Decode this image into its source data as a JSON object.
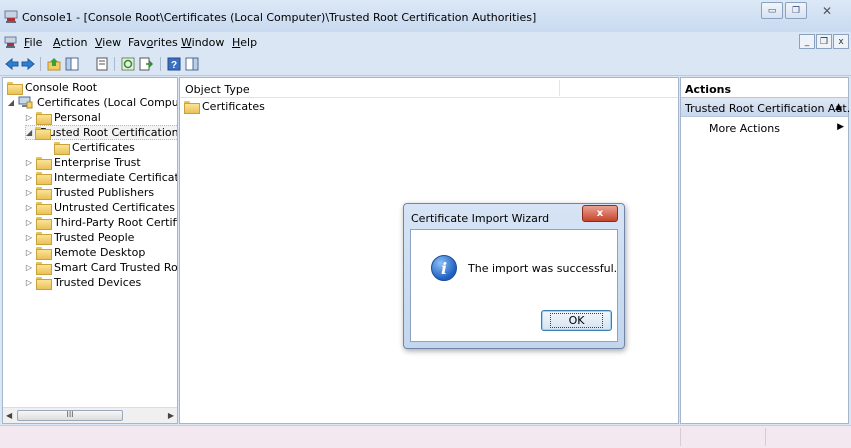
{
  "window": {
    "title": "Console1 - [Console Root\\Certificates (Local Computer)\\Trusted Root Certification Authorities]",
    "minimize_glyph": "▭",
    "restore_glyph": "❐",
    "close_glyph": "✕"
  },
  "menu": {
    "items": [
      {
        "pre": "",
        "ul": "F",
        "post": "ile"
      },
      {
        "pre": "",
        "ul": "A",
        "post": "ction"
      },
      {
        "pre": "",
        "ul": "V",
        "post": "iew"
      },
      {
        "pre": "Fav",
        "ul": "o",
        "post": "rites"
      },
      {
        "pre": "",
        "ul": "W",
        "post": "indow"
      },
      {
        "pre": "",
        "ul": "H",
        "post": "elp"
      }
    ],
    "mdi_minimize": "_",
    "mdi_restore": "❐",
    "mdi_close": "x"
  },
  "tree": {
    "items": [
      {
        "label": "Console Root",
        "expander": ""
      },
      {
        "label": "Certificates (Local Computer)",
        "expander": "◢"
      },
      {
        "label": "Personal",
        "expander": "▷"
      },
      {
        "label": "Trusted Root Certification Au",
        "expander": "◢"
      },
      {
        "label": "Certificates",
        "expander": ""
      },
      {
        "label": "Enterprise Trust",
        "expander": "▷"
      },
      {
        "label": "Intermediate Certification Au",
        "expander": "▷"
      },
      {
        "label": "Trusted Publishers",
        "expander": "▷"
      },
      {
        "label": "Untrusted Certificates",
        "expander": "▷"
      },
      {
        "label": "Third-Party Root Certification",
        "expander": "▷"
      },
      {
        "label": "Trusted People",
        "expander": "▷"
      },
      {
        "label": "Remote Desktop",
        "expander": "▷"
      },
      {
        "label": "Smart Card Trusted Roots",
        "expander": "▷"
      },
      {
        "label": "Trusted Devices",
        "expander": "▷"
      }
    ],
    "scroll_left": "◀",
    "scroll_right": "▶",
    "scroll_thumb": "III"
  },
  "center": {
    "column_header": "Object Type",
    "items": [
      "Certificates"
    ]
  },
  "actions": {
    "title": "Actions",
    "section_label": "Trusted Root Certification Aut...",
    "section_arrow": "▲",
    "more_actions": "More Actions",
    "more_arrow": "▶"
  },
  "dialog": {
    "title": "Certificate Import Wizard",
    "close_glyph": "x",
    "message": "The import was successful.",
    "icon_glyph": "i",
    "ok_label": "OK"
  },
  "colors": {
    "accent": "#1f5fbf",
    "folder": "#e9c15a",
    "close_button": "#c6442d"
  }
}
